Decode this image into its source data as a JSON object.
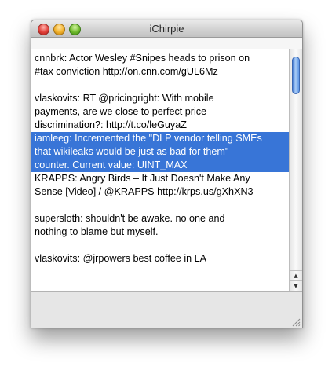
{
  "window": {
    "title": "iChirpie"
  },
  "icons": {
    "close": "close-button",
    "minimize": "minimize-button",
    "zoom": "zoom-button",
    "scroll_up": "scroll-up-icon",
    "scroll_down": "scroll-down-icon",
    "resize": "resize-grip-icon"
  },
  "colors": {
    "selection": "#3875d7",
    "selection_text": "#ffffff",
    "scroll_thumb": "#4a7fd6"
  },
  "timeline": {
    "items": [
      {
        "lines": [
          "cnnbrk: Actor Wesley #Snipes heads to prison on",
          "#tax conviction http://on.cnn.com/gUL6Mz"
        ],
        "selected": false
      },
      {
        "lines": [
          "vlaskovits: RT @pricingright: With mobile",
          "payments, are we close to perfect price",
          "discrimination?: http://t.co/leGuyaZ"
        ],
        "selected": false
      },
      {
        "lines": [
          "iamleeg: Incremented the \"DLP vendor telling SMEs",
          "that wikileaks would be just as bad for them\"",
          "counter. Current value: UINT_MAX"
        ],
        "selected": true
      },
      {
        "lines": [
          "KRAPPS: Angry Birds – It Just Doesn't Make Any",
          "Sense [Video] / @KRAPPS http://krps.us/gXhXN3"
        ],
        "selected": false
      },
      {
        "lines": [
          "supersloth: shouldn't be awake. no one and",
          "nothing to blame but myself."
        ],
        "selected": false
      },
      {
        "lines": [
          "vlaskovits: @jrpowers best coffee in LA"
        ],
        "selected": false
      }
    ]
  }
}
